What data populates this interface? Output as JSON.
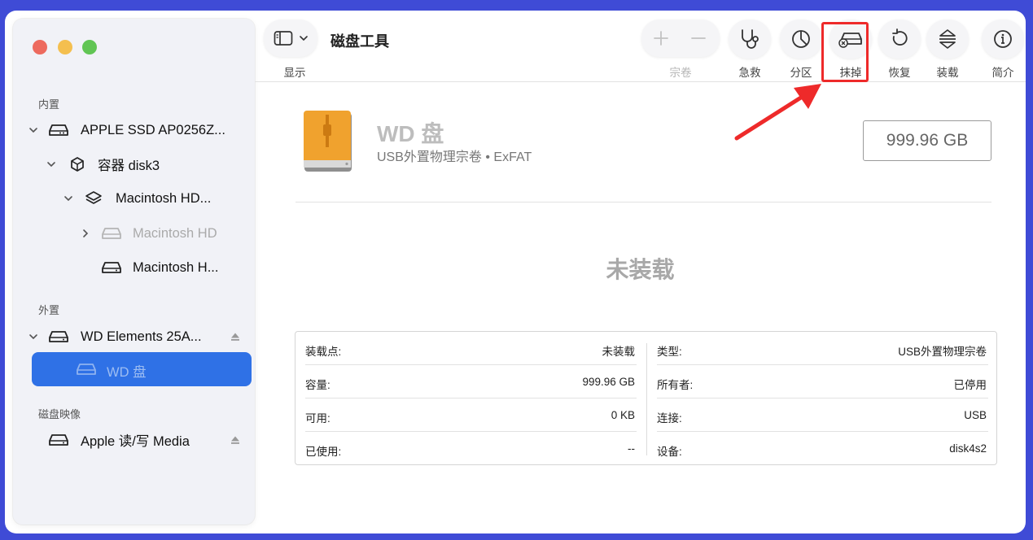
{
  "toolbar": {
    "title": "磁盘工具",
    "view_label": "显示",
    "volume_label": "宗卷",
    "first_aid_label": "急救",
    "partition_label": "分区",
    "erase_label": "抹掉",
    "restore_label": "恢复",
    "mount_label": "装载",
    "info_label": "简介"
  },
  "sidebar": {
    "internal_header": "内置",
    "external_header": "外置",
    "images_header": "磁盘映像",
    "items": [
      {
        "label": "APPLE SSD AP0256Z..."
      },
      {
        "label": "容器 disk3"
      },
      {
        "label": "Macintosh HD..."
      },
      {
        "label": "Macintosh HD"
      },
      {
        "label": "Macintosh H..."
      },
      {
        "label": "WD Elements 25A..."
      },
      {
        "label": "WD 盘"
      },
      {
        "label": "Apple 读/写 Media"
      }
    ]
  },
  "disk": {
    "name": "WD 盘",
    "subtitle": "USB外置物理宗卷 • ExFAT",
    "capacity_badge": "999.96 GB",
    "mount_status": "未装载"
  },
  "info": {
    "left": [
      {
        "key": "装载点:",
        "value": "未装载"
      },
      {
        "key": "容量:",
        "value": "999.96 GB"
      },
      {
        "key": "可用:",
        "value": "0 KB"
      },
      {
        "key": "已使用:",
        "value": "--"
      }
    ],
    "right": [
      {
        "key": "类型:",
        "value": "USB外置物理宗卷"
      },
      {
        "key": "所有者:",
        "value": "已停用"
      },
      {
        "key": "连接:",
        "value": "USB"
      },
      {
        "key": "设备:",
        "value": "disk4s2"
      }
    ]
  },
  "colors": {
    "accent": "#2f71e6",
    "highlight": "#ee2a2a",
    "drive_orange": "#f0a22e"
  }
}
